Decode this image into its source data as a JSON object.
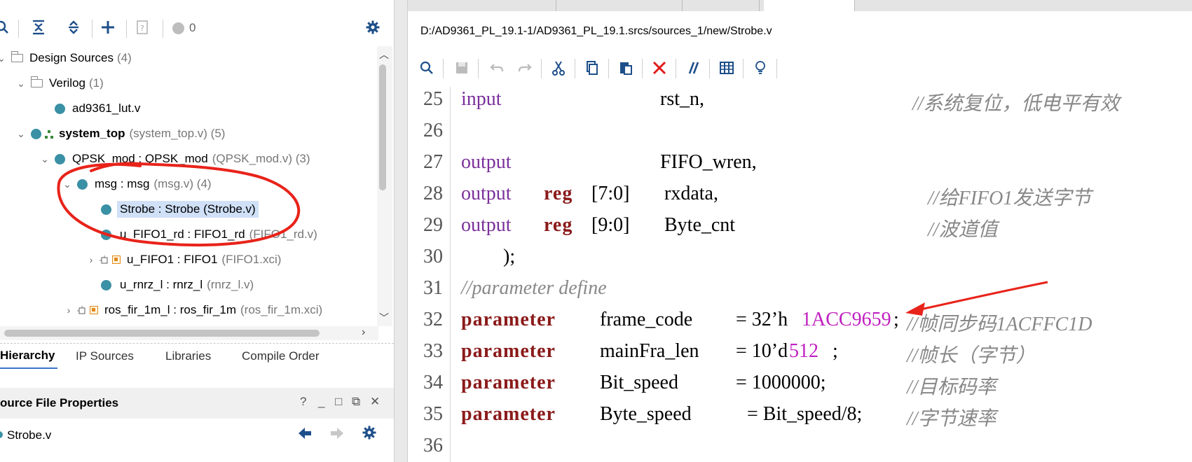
{
  "hierarchy_toolbar": {
    "count": "0",
    "icons": [
      "search-icon",
      "collapse-all-icon",
      "expand-all-icon",
      "add-icon",
      "unknown-file-icon",
      "status-dot-icon",
      "gear-icon"
    ]
  },
  "tree": {
    "design_sources": {
      "label": "Design Sources",
      "count": "(4)"
    },
    "verilog": {
      "label": "Verilog",
      "count": "(1)"
    },
    "ad9361_lut": {
      "label": "ad9361_lut.v"
    },
    "system_top": {
      "label": "system_top",
      "file": "(system_top.v) (5)"
    },
    "qpsk_mod": {
      "label": "QPSK_mod : QPSK_mod",
      "file": "(QPSK_mod.v) (3)"
    },
    "msg": {
      "label": "msg : msg",
      "file": "(msg.v) (4)"
    },
    "strobe": {
      "label": "Strobe : Strobe (Strobe.v)"
    },
    "u_fifo1_rd": {
      "label": "u_FIFO1_rd : FIFO1_rd",
      "file": "(FIFO1_rd.v)"
    },
    "u_fifo1": {
      "label": "u_FIFO1 : FIFO1",
      "file": "(FIFO1.xci)"
    },
    "u_rnrz": {
      "label": "u_rnrz_l : rnrz_l",
      "file": "(rnrz_l.v)"
    },
    "ros_fir": {
      "label": "ros_fir_1m_l : ros_fir_1m",
      "file": "(ros_fir_1m.xci)"
    }
  },
  "tabs": [
    "Hierarchy",
    "IP Sources",
    "Libraries",
    "Compile Order"
  ],
  "properties": {
    "title": "ource File Properties",
    "file": "Strobe.v",
    "controls": [
      "?",
      "_",
      "□",
      "⧉",
      "✕"
    ]
  },
  "editor": {
    "path": "D:/AD9361_PL_19.1-1/AD9361_PL_19.1.srcs/sources_1/new/Strobe.v",
    "toolbar_icons": [
      "search-icon",
      "save-icon",
      "undo-icon",
      "redo-icon",
      "cut-icon",
      "copy-icon",
      "paste-icon",
      "delete-icon",
      "comment-icon",
      "columns-icon",
      "lightbulb-icon"
    ],
    "lines": [
      {
        "n": "25",
        "t": [
          [
            "kw",
            "input"
          ],
          [
            "id",
            "rst_n,"
          ],
          [
            "cmt",
            "//系统复位，低电平有效"
          ]
        ]
      },
      {
        "n": "26",
        "t": []
      },
      {
        "n": "27",
        "t": [
          [
            "kw",
            "output"
          ],
          [
            "id",
            "FIFO_wren,"
          ]
        ]
      },
      {
        "n": "28",
        "t": [
          [
            "kw",
            "output"
          ],
          [
            "kw2",
            "reg"
          ],
          [
            "id",
            "[7:0]"
          ],
          [
            "id",
            "rxdata,"
          ],
          [
            "cmt",
            "//给FIFO1发送字节"
          ]
        ]
      },
      {
        "n": "29",
        "t": [
          [
            "kw",
            "output"
          ],
          [
            "kw2",
            "reg"
          ],
          [
            "id",
            "[9:0]"
          ],
          [
            "id",
            "Byte_cnt"
          ],
          [
            "cmt",
            "//波道值"
          ]
        ]
      },
      {
        "n": "30",
        "t": [
          [
            "id",
            ");"
          ]
        ]
      },
      {
        "n": "31",
        "t": [
          [
            "cmt",
            "//parameter define"
          ]
        ]
      },
      {
        "n": "32",
        "t": [
          [
            "kw2",
            "parameter"
          ],
          [
            "id",
            "frame_code"
          ],
          [
            "id",
            "= 32’h"
          ],
          [
            "num",
            "1ACC9659"
          ],
          [
            "id",
            ";"
          ],
          [
            "cmt",
            "//帧同步码1ACFFC1D"
          ]
        ]
      },
      {
        "n": "33",
        "t": [
          [
            "kw2",
            "parameter"
          ],
          [
            "id",
            "mainFra_len"
          ],
          [
            "id",
            "= 10’d"
          ],
          [
            "num",
            "512"
          ],
          [
            "id",
            ";"
          ],
          [
            "cmt",
            "//帧长（字节）"
          ]
        ]
      },
      {
        "n": "34",
        "t": [
          [
            "kw2",
            "parameter"
          ],
          [
            "id",
            "Bit_speed"
          ],
          [
            "id",
            "= 1000000;"
          ],
          [
            "cmt",
            "//目标码率"
          ]
        ]
      },
      {
        "n": "35",
        "t": [
          [
            "kw2",
            "parameter"
          ],
          [
            "id",
            "Byte_speed"
          ],
          [
            "id",
            "= Bit_speed/8;"
          ],
          [
            "cmt",
            "//字节速率"
          ]
        ]
      },
      {
        "n": "36",
        "t": []
      }
    ]
  },
  "colors": {
    "keyword": "#7b2f9c",
    "reg_param": "#8b1a1a",
    "comment": "#888888",
    "number": "#c020c0",
    "annotation": "#e8231a",
    "selection": "#cfe0f7"
  }
}
